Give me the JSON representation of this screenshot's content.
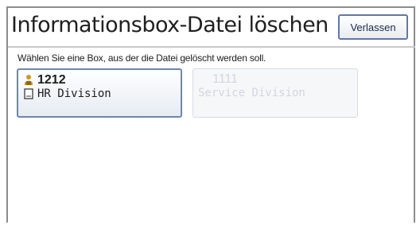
{
  "header": {
    "title": "Informationsbox-Datei löschen",
    "exit_label": "Verlassen"
  },
  "instruction": "Wählen Sie eine Box, aus der die Datei gelöscht werden soll.",
  "boxes": [
    {
      "number": "1212",
      "name": "HR Division",
      "enabled": true,
      "icons": [
        "user-lock-icon",
        "document-icon"
      ]
    },
    {
      "number": "1111",
      "name": "Service Division",
      "enabled": false,
      "icons": []
    }
  ],
  "colors": {
    "button_border": "#5c7aa8",
    "disabled_text": "#d2d6de"
  }
}
